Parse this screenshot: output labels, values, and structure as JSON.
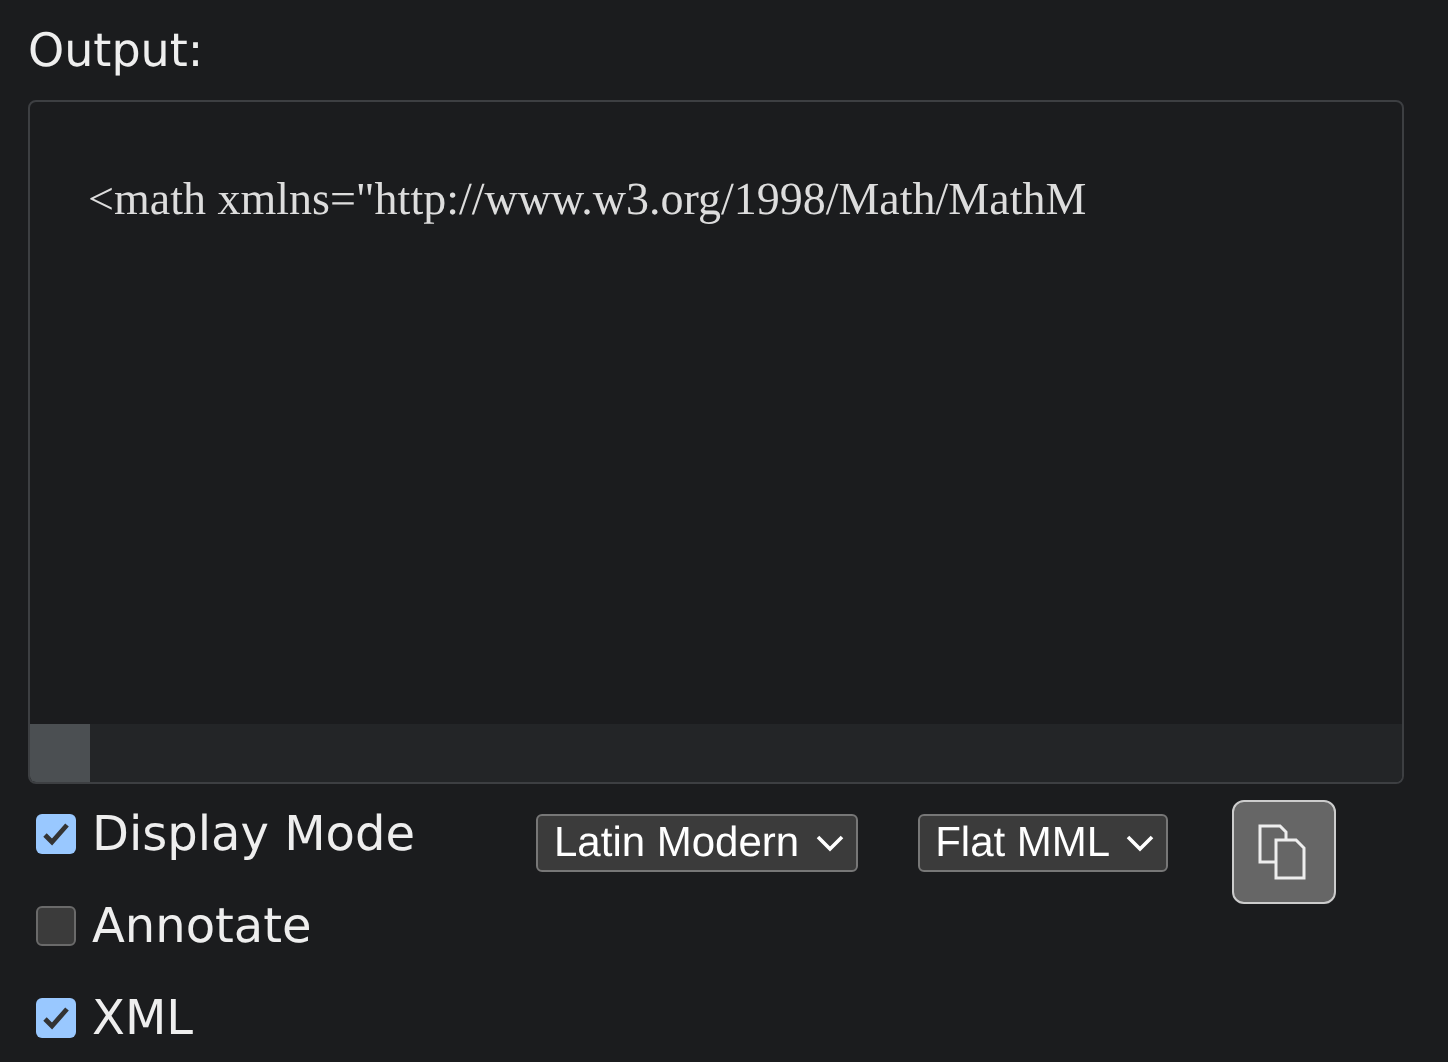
{
  "output": {
    "label": "Output:",
    "code": "<math xmlns=\"http://www.w3.org/1998/Math/MathM"
  },
  "options": [
    {
      "label": "Display Mode",
      "checked": true
    },
    {
      "label": "Annotate",
      "checked": false
    },
    {
      "label": "XML",
      "checked": true
    }
  ],
  "selects": [
    {
      "value": "Latin Modern"
    },
    {
      "value": "Flat MML"
    }
  ]
}
